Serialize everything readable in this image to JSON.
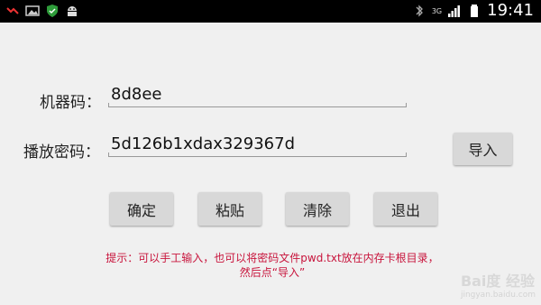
{
  "statusbar": {
    "time": "19:41",
    "network": "3G",
    "icons": [
      "missed-call-icon",
      "image-icon",
      "shield-icon",
      "android-icon",
      "bluetooth-icon",
      "signal-icon",
      "battery-icon"
    ]
  },
  "form": {
    "machine_code_label": "机器码：",
    "machine_code_value": "8d8ee",
    "play_password_label": "播放密码：",
    "play_password_value": "5d126b1xdax329367d"
  },
  "buttons": {
    "import": "导入",
    "confirm": "确定",
    "paste": "粘贴",
    "clear": "清除",
    "exit": "退出"
  },
  "hint": {
    "line1": "提示：可以手工输入，也可以将密码文件pwd.txt放在内存卡根目录，",
    "line2": "然后点“导入”"
  },
  "watermark": {
    "brand": "Bai度 经验",
    "url": "jingyan.baidu.com"
  },
  "colors": {
    "background": "#f0f0f0",
    "statusbar": "#000000",
    "button": "#d8d8d8",
    "hint": "#c8143c"
  }
}
